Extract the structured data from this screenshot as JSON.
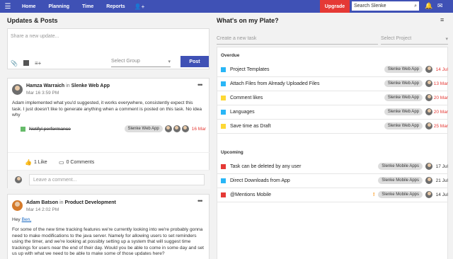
{
  "topbar": {
    "nav": [
      "Home",
      "Planning",
      "Time",
      "Reports"
    ],
    "upgrade_label": "Upgrade",
    "search_value": "Search Slenke",
    "icons": [
      "hamburger-icon",
      "add-user-icon",
      "search-icon",
      "bell-icon",
      "mail-icon"
    ]
  },
  "updates": {
    "title": "Updates & Posts",
    "composer_placeholder": "Share a new update...",
    "select_group": "Select Group",
    "post_label": "Post"
  },
  "posts": [
    {
      "author": "Hamza Warraich",
      "in": "in",
      "project": "Slenke Web App",
      "time": "Mar 16 3:59 PM",
      "body": "Adam implemented what you'd suggested, it works everywhere, consistently expect this task. I just doesn't like to generate anything when a comment is posted on this task. No idea why",
      "task_name": "Notifyl performance",
      "task_chip": "Slenke Web App",
      "task_date": "16 Mar",
      "likes": "1 Like",
      "comments": "0 Comments",
      "comment_placeholder": "Leave a comment..."
    },
    {
      "author": "Adam Batson",
      "in": "in",
      "project": "Product Development",
      "time": "Mar 14 2:02 PM",
      "greeting": "Hey",
      "mention": "Ben,",
      "body": "For some of the new time tracking features we're currently looking into we're probably gonna need to make modifications to the java server.  Namely for allowing users to set reminders using the timer, and we're looking at possibly setting up a system that will suggest time trackings for users near the end of their day.  Would you be able to come in some day and set us up with what we need to be able to make some of those updates here?"
    }
  ],
  "plate": {
    "title": "What's on my Plate?",
    "create_placeholder": "Create a new task",
    "select_project": "Select Project",
    "overdue_label": "Overdue",
    "upcoming_label": "Upcoming",
    "overdue": [
      {
        "name": "Project Templates",
        "chip": "Slenke Web App",
        "date": "14 Jul",
        "color": "#29b6f6",
        "date_color": "#e53935"
      },
      {
        "name": "Attach Files from Already Uploaded Files",
        "chip": "Slenke Web App",
        "date": "13 Mar",
        "color": "#29b6f6",
        "date_color": "#e53935"
      },
      {
        "name": "Comment likes",
        "chip": "Slenke Web App",
        "date": "20 Mar",
        "color": "#fdd835",
        "date_color": "#e53935"
      },
      {
        "name": "Languages",
        "chip": "Slenke Web App",
        "date": "20 Mar",
        "color": "#29b6f6",
        "date_color": "#e53935"
      },
      {
        "name": "Save time as Draft",
        "chip": "Slenke Web App",
        "date": "25 Mar",
        "color": "#fdd835",
        "date_color": "#e53935"
      }
    ],
    "upcoming": [
      {
        "name": "Task can be deleted by any user",
        "chip": "Slenke Mobile Apps",
        "date": "17 Jul",
        "color": "#e53935",
        "date_color": "#333333"
      },
      {
        "name": "Direct Downloads from App",
        "chip": "Slenke Mobile Apps",
        "date": "21 Jul",
        "color": "#29b6f6",
        "date_color": "#333333"
      },
      {
        "name": "@Mentions Mobile",
        "chip": "Slenke Mobile Apps",
        "date": "14 Jul",
        "color": "#e53935",
        "date_color": "#333333",
        "flag": "!"
      }
    ]
  }
}
